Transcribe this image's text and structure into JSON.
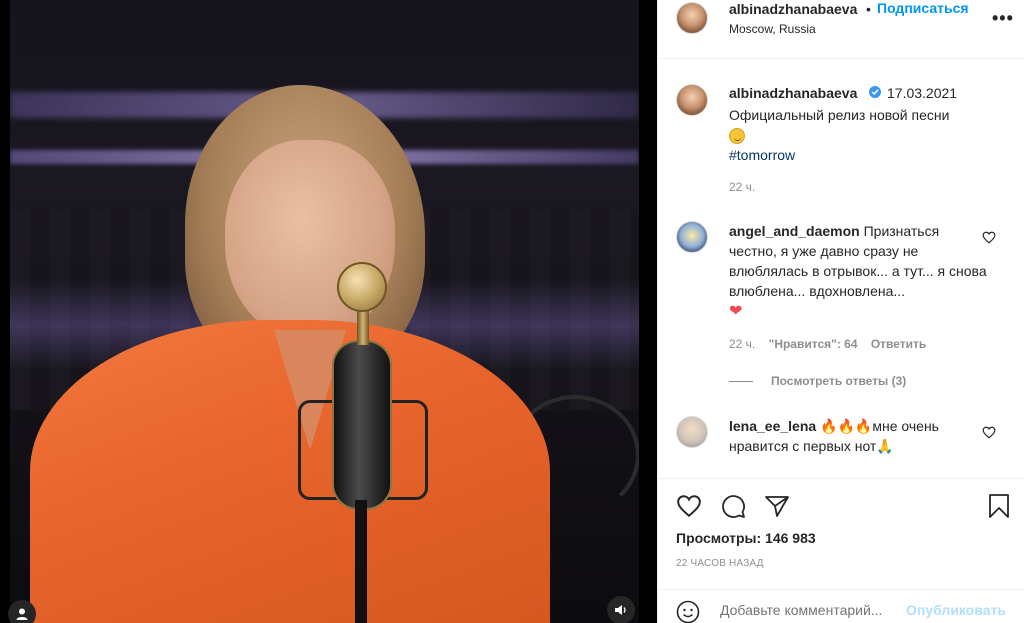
{
  "post": {
    "author": "albinadzhanabaeva",
    "follow_label": "Подписаться",
    "dot": "•",
    "location": "Moscow, Russia",
    "more_label": "•••"
  },
  "caption": {
    "author": "albinadzhanabaeva",
    "date": "17.03.2021",
    "text": "Официальный релиз новой песни",
    "hashtag": "#tomorrow",
    "time": "22 ч."
  },
  "comments": [
    {
      "user": "angel_and_daemon",
      "text": "Признаться честно, я уже давно сразу не влюблялась в отрывок... а тут... я снова влюблена... вдохновлена...",
      "emoji": "❤",
      "time": "22 ч.",
      "likes": "\"Нравится\": 64",
      "reply_label": "Ответить",
      "view_replies": "Посмотреть ответы (3)"
    },
    {
      "user": "lena_ee_lena",
      "emoji": "🔥🔥🔥",
      "text": "мне очень нравится с первых нот",
      "emoji_end": "🙏"
    }
  ],
  "stats": {
    "views": "Просмотры: 146 983",
    "ago": "22 ЧАСОВ НАЗАД"
  },
  "add_comment": {
    "placeholder": "Добавьте комментарий...",
    "publish_label": "Опубликовать"
  },
  "colors": {
    "accent": "#0095f6",
    "text": "#262626",
    "muted": "#8e8e8e",
    "border": "#efefef",
    "like_red": "#ed4956"
  },
  "icons": [
    "user-icon",
    "volume-icon",
    "more-icon",
    "verified-icon",
    "heart-icon",
    "comment-icon",
    "share-icon",
    "bookmark-icon",
    "emoji-icon"
  ]
}
